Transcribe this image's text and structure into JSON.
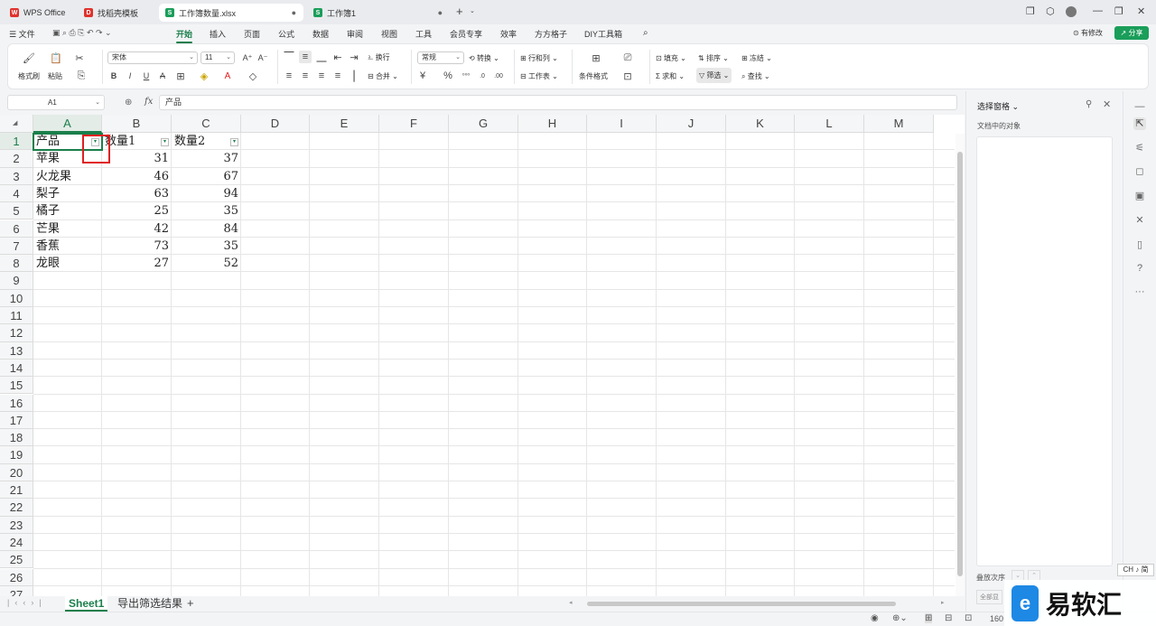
{
  "tabs": [
    {
      "label": "WPS Office",
      "icon": "wps-logo-icon",
      "color": "#e0322d"
    },
    {
      "label": "找稻壳模板",
      "icon": "docer-icon",
      "color": "#e0322d"
    },
    {
      "label": "工作簿数量.xlsx",
      "icon": "spreadsheet-icon",
      "color": "#1a9e5a"
    },
    {
      "label": "工作簿1",
      "icon": "spreadsheet-icon",
      "color": "#1a9e5a"
    }
  ],
  "menu": {
    "file": "文件",
    "items": [
      "开始",
      "插入",
      "页面",
      "公式",
      "数据",
      "审阅",
      "视图",
      "工具",
      "会员专享",
      "效率",
      "方方格子",
      "DIY工具箱"
    ],
    "active": "开始",
    "has_changes": "有修改",
    "share": "分享"
  },
  "ribbon": {
    "format_painter": "格式刷",
    "paste": "粘贴",
    "font_name": "宋体",
    "font_size": "11",
    "bold": "B",
    "italic": "I",
    "underline": "U",
    "wrap": "换行",
    "merge": "合并",
    "number_format": "常规",
    "convert": "转换",
    "row_col": "行和列",
    "worksheet": "工作表",
    "cond_format": "条件格式",
    "fill": "填充",
    "sort": "排序",
    "freeze": "冻结",
    "sum": "求和",
    "filter": "筛选",
    "find": "查找"
  },
  "formula_bar": {
    "cell_ref": "A1",
    "fx": "fx",
    "content": "产品"
  },
  "columns": [
    "A",
    "B",
    "C",
    "D",
    "E",
    "F",
    "G",
    "H",
    "I",
    "J",
    "K",
    "L",
    "M"
  ],
  "rows": [
    "1",
    "2",
    "3",
    "4",
    "5",
    "6",
    "7",
    "8",
    "9",
    "10",
    "11",
    "12",
    "13",
    "14",
    "15",
    "16",
    "17",
    "18",
    "19",
    "20",
    "21",
    "22",
    "23",
    "24",
    "25",
    "26",
    "27"
  ],
  "headers": [
    "产品",
    "数量1",
    "数量2"
  ],
  "data": [
    [
      "苹果",
      "31",
      "37"
    ],
    [
      "火龙果",
      "46",
      "67"
    ],
    [
      "梨子",
      "63",
      "94"
    ],
    [
      "橘子",
      "25",
      "35"
    ],
    [
      "芒果",
      "42",
      "84"
    ],
    [
      "香蕉",
      "73",
      "35"
    ],
    [
      "龙眼",
      "27",
      "52"
    ]
  ],
  "sheets": [
    "Sheet1",
    "导出筛选结果"
  ],
  "active_sheet": "Sheet1",
  "right_panel": {
    "title": "选择窗格",
    "subtitle": "文档中的对象",
    "order_label": "叠放次序",
    "show_all": "全部显"
  },
  "status": {
    "zoom": "160"
  },
  "ime": "CH ♪ 简",
  "watermark": "易软汇",
  "colors": {
    "accent": "#1a7f4b",
    "highlight_box": "#e02020"
  }
}
